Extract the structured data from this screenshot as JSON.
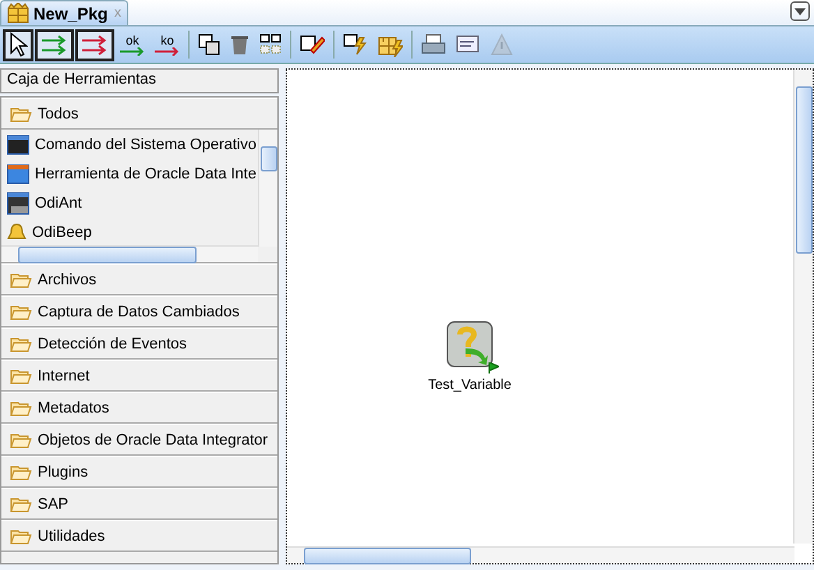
{
  "tab": {
    "title": "New_Pkg",
    "close": "x",
    "selected": true
  },
  "toolbar": [
    {
      "kind": "select",
      "selected": true
    },
    {
      "kind": "green-link",
      "selected": true
    },
    {
      "kind": "red-link",
      "selected": true
    },
    {
      "kind": "ok-link",
      "label": "ok",
      "selected": false
    },
    {
      "kind": "ko-link",
      "label": "ko",
      "selected": false
    },
    {
      "kind": "duplicate",
      "selected": false
    },
    {
      "kind": "delete",
      "selected": false
    },
    {
      "kind": "align",
      "selected": false
    },
    {
      "kind": "edit",
      "selected": false
    },
    {
      "kind": "execute",
      "selected": false
    },
    {
      "kind": "execute-step",
      "selected": false
    },
    {
      "kind": "print",
      "selected": false
    },
    {
      "kind": "properties",
      "selected": false
    },
    {
      "kind": "warning",
      "selected": false,
      "disabled": true
    }
  ],
  "toolbox": {
    "title": "Caja de Herramientas",
    "sections": [
      {
        "label": "Todos",
        "items": [
          {
            "kind": "console",
            "label": "Comando del Sistema Operativo"
          },
          {
            "kind": "tool",
            "label": "Herramienta de Oracle Data Inte"
          },
          {
            "kind": "ant",
            "label": "OdiAnt"
          },
          {
            "kind": "bell",
            "label": "OdiBeep"
          }
        ]
      },
      {
        "label": "Archivos"
      },
      {
        "label": "Captura de Datos Cambiados"
      },
      {
        "label": "Detección de Eventos"
      },
      {
        "label": "Internet"
      },
      {
        "label": "Metadatos"
      },
      {
        "label": "Objetos de Oracle Data Integrator"
      },
      {
        "label": "Plugins"
      },
      {
        "label": "SAP"
      },
      {
        "label": "Utilidades"
      }
    ]
  },
  "canvas": {
    "nodes": [
      {
        "label": "Test_Variable",
        "first_step": true
      }
    ]
  }
}
